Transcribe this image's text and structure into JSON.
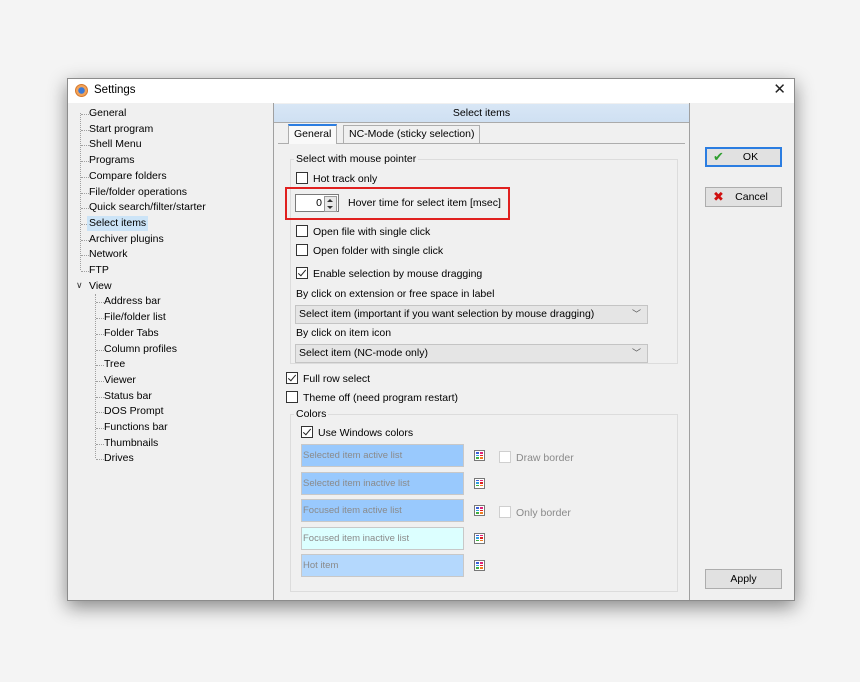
{
  "window": {
    "title": "Settings",
    "close_glyph": "✕"
  },
  "tree": {
    "items": [
      {
        "label": "General",
        "level": 0
      },
      {
        "label": "Start program",
        "level": 0
      },
      {
        "label": "Shell Menu",
        "level": 0
      },
      {
        "label": "Programs",
        "level": 0
      },
      {
        "label": "Compare folders",
        "level": 0
      },
      {
        "label": "File/folder operations",
        "level": 0
      },
      {
        "label": "Quick search/filter/starter",
        "level": 0
      },
      {
        "label": "Select items",
        "level": 0,
        "selected": true
      },
      {
        "label": "Archiver plugins",
        "level": 0
      },
      {
        "label": "Network",
        "level": 0
      },
      {
        "label": "FTP",
        "level": 0
      },
      {
        "label": "View",
        "level": 0,
        "expanded": true
      },
      {
        "label": "Address bar",
        "level": 1
      },
      {
        "label": "File/folder list",
        "level": 1
      },
      {
        "label": "Folder Tabs",
        "level": 1
      },
      {
        "label": "Column profiles",
        "level": 1
      },
      {
        "label": "Tree",
        "level": 1
      },
      {
        "label": "Viewer",
        "level": 1
      },
      {
        "label": "Status bar",
        "level": 1
      },
      {
        "label": "DOS Prompt",
        "level": 1
      },
      {
        "label": "Functions bar",
        "level": 1
      },
      {
        "label": "Thumbnails",
        "level": 1
      },
      {
        "label": "Drives",
        "level": 1
      }
    ],
    "expand_glyph": "∨"
  },
  "panel": {
    "header": "Select items",
    "tabs": [
      {
        "label": "General",
        "active": true
      },
      {
        "label": "NC-Mode (sticky selection)",
        "active": false
      }
    ],
    "mouse_group": {
      "title": "Select with mouse pointer",
      "hot_track_only": {
        "label": "Hot track only",
        "checked": false
      },
      "hover_time": {
        "label": "Hover time for select item [msec]",
        "value": "0"
      },
      "open_file_single_click": {
        "label": "Open file with single click",
        "checked": false
      },
      "open_folder_single_click": {
        "label": "Open folder with single click",
        "checked": false
      },
      "enable_drag_selection": {
        "label": "Enable selection by mouse dragging",
        "checked": true
      },
      "click_extension_label": "By click on extension or free space in label",
      "click_extension_value": "Select item (important if you want selection by mouse dragging)",
      "click_icon_label": "By click on item icon",
      "click_icon_value": "Select item (NC-mode only)"
    },
    "full_row_select": {
      "label": "Full row select",
      "checked": true
    },
    "theme_off": {
      "label": "Theme off (need program restart)",
      "checked": false
    },
    "colors_group": {
      "title": "Colors",
      "use_windows_colors": {
        "label": "Use Windows colors",
        "checked": true
      },
      "swatches": [
        {
          "label": "Selected item active list",
          "color": "#99c9fd"
        },
        {
          "label": "Selected item inactive list",
          "color": "#99c9fd"
        },
        {
          "label": "Focused item active list",
          "color": "#99c9fd"
        },
        {
          "label": "Focused item inactive list",
          "color": "#dcffff"
        },
        {
          "label": "Hot item",
          "color": "#b4d8fd"
        }
      ],
      "draw_border": {
        "label": "Draw border",
        "checked": false
      },
      "only_border": {
        "label": "Only border",
        "checked": false
      }
    }
  },
  "buttons": {
    "ok": "OK",
    "cancel": "Cancel",
    "apply": "Apply",
    "ok_icon": "✔",
    "cancel_icon": "✖"
  },
  "colors": {
    "highlight_border": "#e0201f",
    "ok_icon": "#2e9e2e",
    "cancel_icon": "#d01010",
    "accent": "#2b7de1"
  }
}
